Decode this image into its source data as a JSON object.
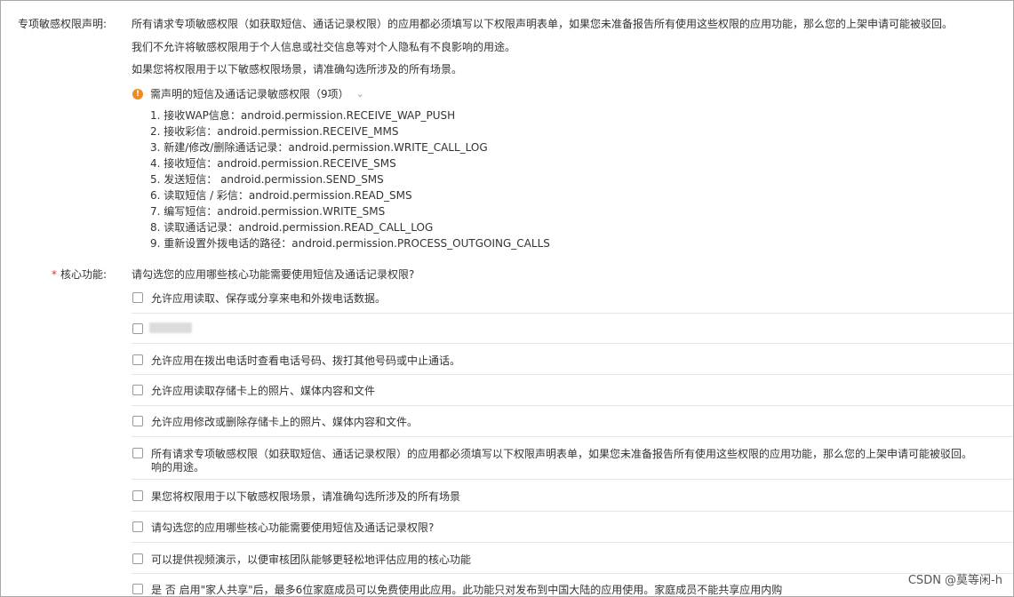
{
  "declaration": {
    "label": "专项敏感权限声明:",
    "para1": "所有请求专项敏感权限（如获取短信、通话记录权限）的应用都必须填写以下权限声明表单，如果您未准备报告所有使用这些权限的应用功能，那么您的上架申请可能被驳回。",
    "para2": "我们不允许将敏感权限用于个人信息或社交信息等对个人隐私有不良影响的用途。",
    "para3": "如果您将权限用于以下敏感权限场景，请准确勾选所涉及的所有场景。",
    "warn_title": "需声明的短信及通话记录敏感权限（9项）",
    "permissions": [
      "1. 接收WAP信息：android.permission.RECEIVE_WAP_PUSH",
      "2. 接收彩信：android.permission.RECEIVE_MMS",
      "3. 新建/修改/删除通话记录：android.permission.WRITE_CALL_LOG",
      "4. 接收短信：android.permission.RECEIVE_SMS",
      "5. 发送短信： android.permission.SEND_SMS",
      "6. 读取短信 / 彩信：android.permission.READ_SMS",
      "7. 编写短信：android.permission.WRITE_SMS",
      "8. 读取通话记录：android.permission.READ_CALL_LOG",
      "9. 重新设置外拨电话的路径：android.permission.PROCESS_OUTGOING_CALLS"
    ]
  },
  "core": {
    "required_mark": "*",
    "label": "核心功能:",
    "question": "请勾选您的应用哪些核心功能需要使用短信及通话记录权限?",
    "options": [
      {
        "text": "允许应用读取、保存或分享来电和外拨电话数据。",
        "text2": ""
      },
      {
        "text": "",
        "text2": ""
      },
      {
        "text": "允许应用在拨出电话时查看电话号码、拨打其他号码或中止通话。",
        "text2": ""
      },
      {
        "text": "允许应用读取存储卡上的照片、媒体内容和文件",
        "text2": ""
      },
      {
        "text": "允许应用修改或删除存储卡上的照片、媒体内容和文件。",
        "text2": ""
      },
      {
        "text": "所有请求专项敏感权限（如获取短信、通话记录权限）的应用都必须填写以下权限声明表单，如果您未准备报告所有使用这些权限的应用功能，那么您的上架申请可能被驳回。",
        "text2": "响的用途。"
      },
      {
        "text": "果您将权限用于以下敏感权限场景，请准确勾选所涉及的所有场景",
        "text2": ""
      },
      {
        "text": "请勾选您的应用哪些核心功能需要使用短信及通话记录权限?",
        "text2": ""
      },
      {
        "text": "可以提供视频演示，以便审核团队能够更轻松地评估应用的核心功能",
        "text2": ""
      },
      {
        "text": "是 否 启用\"家人共享\"后，最多6位家庭成员可以免费使用此应用。此功能只对发布到中国大陆的应用使用。家庭成员不能共享应用内购",
        "text2": ""
      }
    ]
  },
  "watermark": "CSDN @莫等闲-h"
}
